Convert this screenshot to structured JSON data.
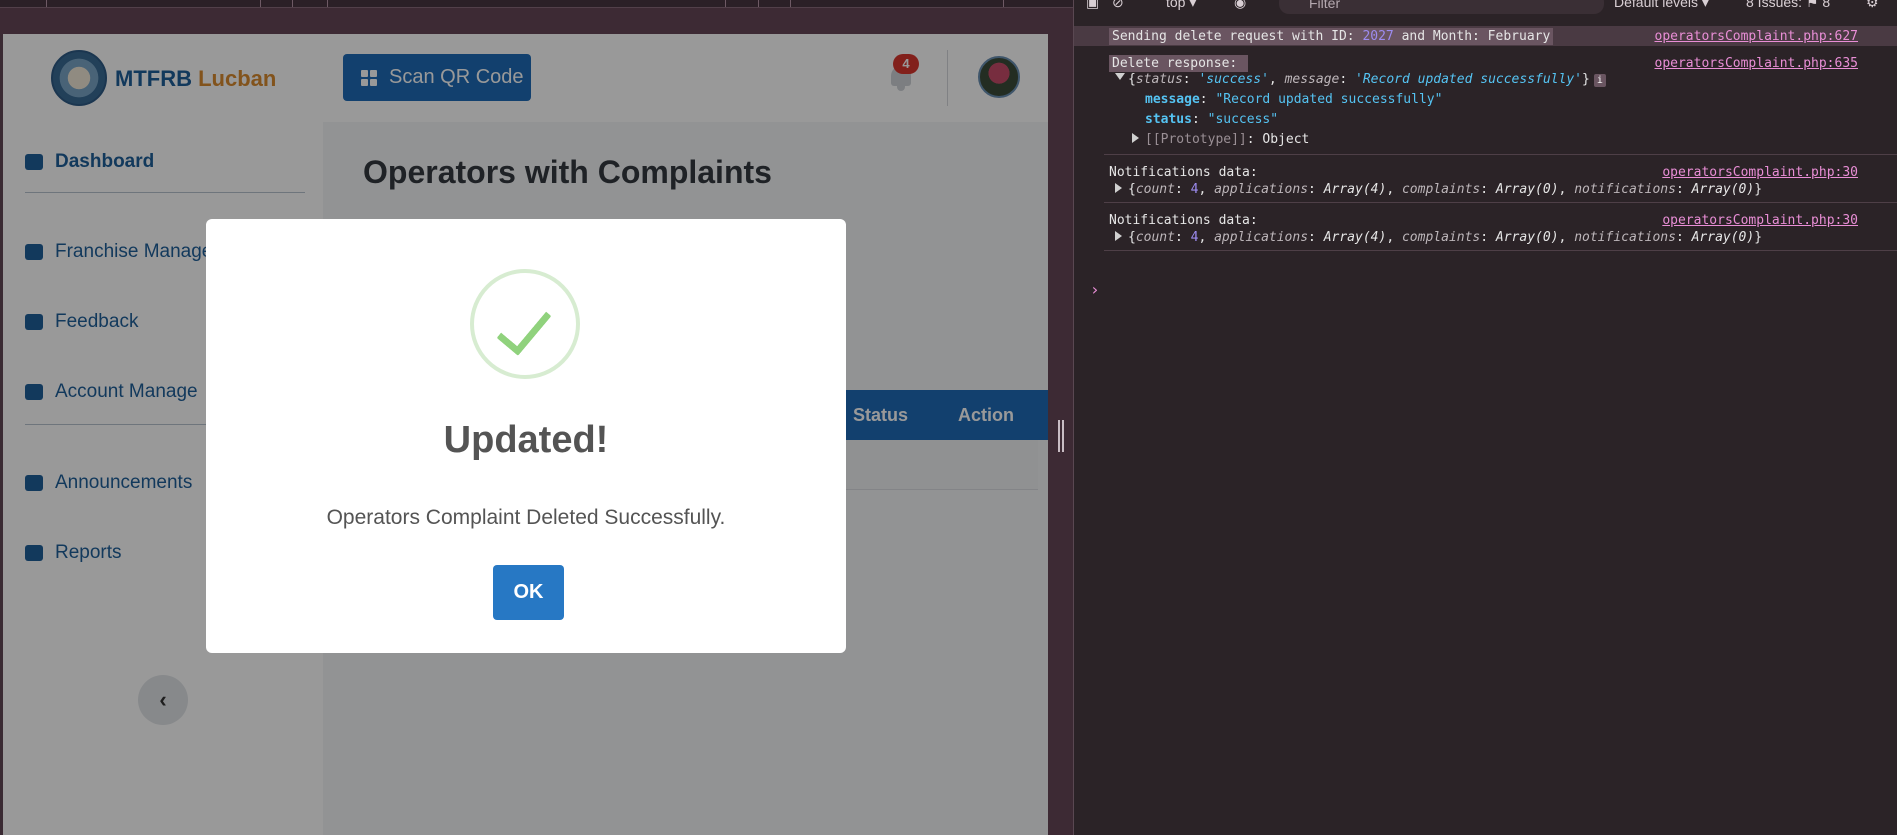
{
  "app": {
    "brand_main": "MTFRB",
    "brand_accent": "Lucban",
    "scan_button": "Scan QR Code",
    "notification_count": "4",
    "sidebar": {
      "items": [
        {
          "label": "Dashboard",
          "icon": "dashboard-icon"
        },
        {
          "label": "Franchise Manage",
          "icon": "user-gear-icon"
        },
        {
          "label": "Feedback",
          "icon": "comment-icon"
        },
        {
          "label": "Account Manage",
          "icon": "users-icon"
        },
        {
          "label": "Announcements",
          "icon": "newspaper-icon"
        },
        {
          "label": "Reports",
          "icon": "chart-icon"
        }
      ],
      "collapse_icon": "‹"
    },
    "page_title": "Operators with Complaints",
    "table": {
      "headers": [
        "Status",
        "Action"
      ]
    },
    "modal": {
      "title": "Updated!",
      "message": "Operators Complaint Deleted Successfully.",
      "ok_label": "OK"
    }
  },
  "devtools": {
    "context": "top",
    "filter_placeholder": "Filter",
    "levels": "Default levels",
    "issues": "8 Issues:",
    "issues_count": "8",
    "logs": {
      "l1_prefix": "Sending delete request with ID: ",
      "l1_id": "2027",
      "l1_suffix": " and Month: February",
      "l1_src": "operatorsComplaint.php:627",
      "l2_text": "Delete response: ",
      "l2_src": "operatorsComplaint.php:635",
      "obj_status_val": "'success'",
      "obj_message_val": "'Record updated successfully'",
      "prop_message_key": "message",
      "prop_message_val": "\"Record updated successfully\"",
      "prop_status_key": "status",
      "prop_status_val": "\"success\"",
      "prop_proto_key": "[[Prototype]]",
      "prop_proto_val": "Object",
      "n1_text": "Notifications data:",
      "n1_src": "operatorsComplaint.php:30",
      "n2_text": "Notifications data:",
      "n2_src": "operatorsComplaint.php:30",
      "count_val": "4",
      "apps_val": "Array(4)",
      "complaints_val": "Array(0)",
      "notifs_val": "Array(0)"
    }
  }
}
